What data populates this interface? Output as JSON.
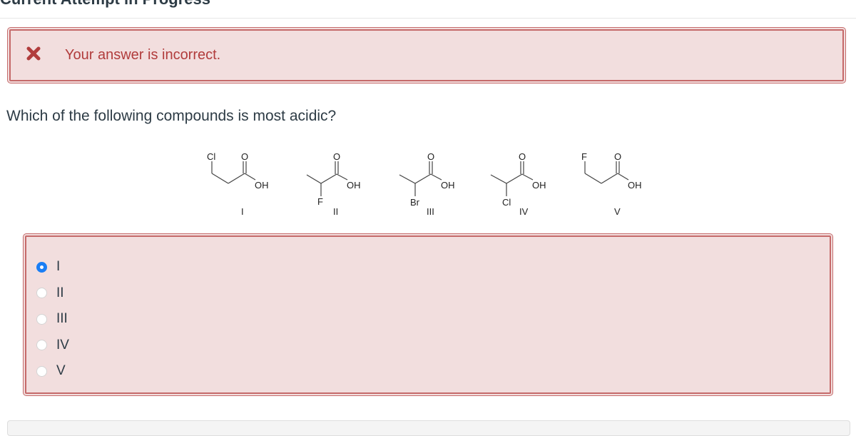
{
  "page": {
    "heading": "Current Attempt in Progress"
  },
  "feedback": {
    "icon": "x-mark-icon",
    "message": "Your answer is incorrect.",
    "color": "#b13c3c",
    "background": "#f2dede"
  },
  "question": {
    "text": "Which of the following compounds is most acidic?",
    "compounds": [
      {
        "label": "I",
        "name": "3-chloropropanoic acid",
        "substituent": "Cl",
        "position": "beta",
        "atoms": {
          "sub": "Cl",
          "carbonyl": "O",
          "hydroxyl": "OH"
        }
      },
      {
        "label": "II",
        "name": "2-fluoropropanoic acid",
        "substituent": "F",
        "position": "alpha",
        "atoms": {
          "sub": "F",
          "carbonyl": "O",
          "hydroxyl": "OH"
        }
      },
      {
        "label": "III",
        "name": "2-bromopropanoic acid",
        "substituent": "Br",
        "position": "alpha",
        "atoms": {
          "sub": "Br",
          "carbonyl": "O",
          "hydroxyl": "OH"
        }
      },
      {
        "label": "IV",
        "name": "2-chloropropanoic acid",
        "substituent": "Cl",
        "position": "alpha",
        "atoms": {
          "sub": "Cl",
          "carbonyl": "O",
          "hydroxyl": "OH"
        }
      },
      {
        "label": "V",
        "name": "3-fluoropropanoic acid",
        "substituent": "F",
        "position": "beta",
        "atoms": {
          "sub": "F",
          "carbonyl": "O",
          "hydroxyl": "OH"
        }
      }
    ]
  },
  "answer": {
    "options": [
      {
        "label": "I",
        "selected": true
      },
      {
        "label": "II",
        "selected": false
      },
      {
        "label": "III",
        "selected": false
      },
      {
        "label": "IV",
        "selected": false
      },
      {
        "label": "V",
        "selected": false
      }
    ],
    "selected_color": "#1a7ef5"
  }
}
